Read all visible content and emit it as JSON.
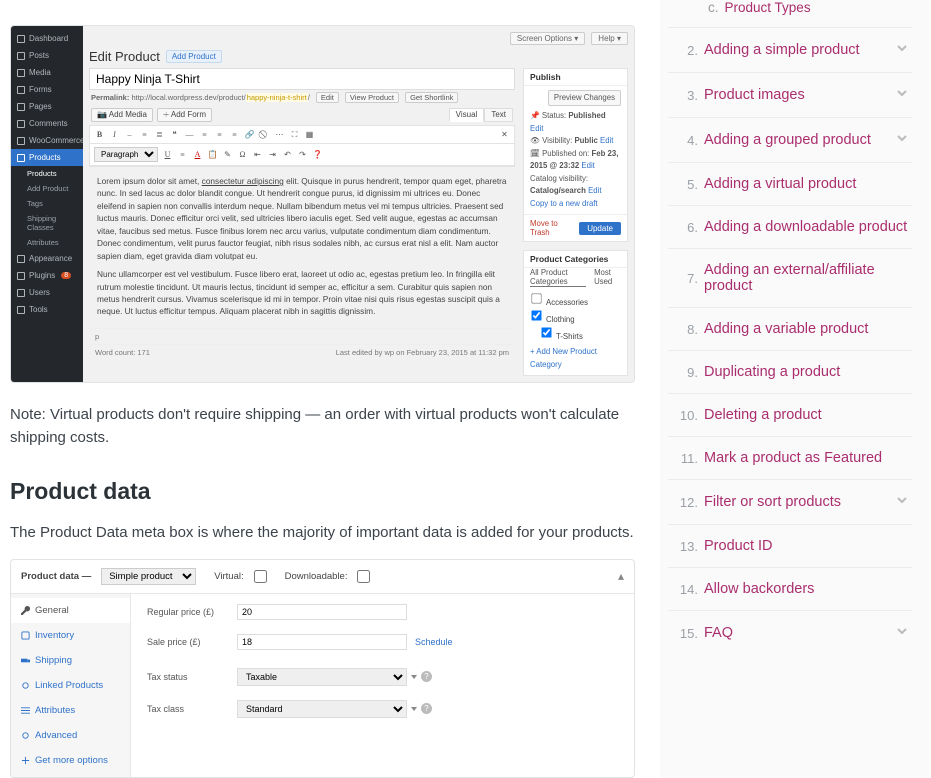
{
  "wp_shot": {
    "screen_options": "Screen Options",
    "help": "Help",
    "menu": [
      {
        "icon": "dash",
        "label": "Dashboard"
      },
      {
        "icon": "pin",
        "label": "Posts"
      },
      {
        "icon": "media",
        "label": "Media"
      },
      {
        "icon": "form",
        "label": "Forms"
      },
      {
        "icon": "page",
        "label": "Pages"
      },
      {
        "icon": "comment",
        "label": "Comments"
      },
      {
        "icon": "cart",
        "label": "WooCommerce"
      }
    ],
    "menu_active": "Products",
    "menu_sub": [
      "Products",
      "Add Product",
      "Tags",
      "Shipping Classes",
      "Attributes"
    ],
    "menu_after": [
      {
        "label": "Appearance",
        "icon": "brush"
      },
      {
        "label": "Plugins",
        "icon": "plug",
        "badge": "8"
      },
      {
        "label": "Users",
        "icon": "user"
      },
      {
        "label": "Tools",
        "icon": "wrench"
      }
    ],
    "page_title": "Edit Product",
    "add_new": "Add Product",
    "product_title": "Happy Ninja T-Shirt",
    "permalink_label": "Permalink:",
    "permalink_url": "http://local.wordpress.dev/product/",
    "permalink_slug": "happy-ninja-t-shirt",
    "permalink_edit": "Edit",
    "permalink_view": "View Product",
    "permalink_shortlink": "Get Shortlink",
    "add_media": "Add Media",
    "add_form": "Add Form",
    "tab_visual": "Visual",
    "tab_text": "Text",
    "tb_paragraph": "Paragraph",
    "content_p1_a": "Lorem ipsum dolor sit amet, ",
    "content_p1_u": "consectetur adipiscing",
    "content_p1_b": " elit. Quisque in purus hendrerit, tempor quam eget, pharetra nunc. In sed lacus ac dolor blandit congue. Ut hendrerit congue purus, id dignissim mi ultrices eu. Donec eleifend in sapien non convallis interdum neque. Nullam bibendum metus vel mi tempus ultricies. Praesent sed luctus mauris. Donec efficitur orci velit, sed ultricies libero iaculis eget. Sed velit augue, egestas ac accumsan vitae, faucibus sed metus. Fusce finibus lorem nec arcu varius, vulputate condimentum diam condimentum. Donec condimentum, velit purus fauctor feugiat, nibh risus sodales nibh, ac cursus erat nisl a elit. Nam auctor sapien diam, eget gravida diam volutpat eu.",
    "content_p2": "Nunc ullamcorper est vel vestibulum. Fusce libero erat, laoreet ut odio ac, egestas pretium leo. In fringilla elit rutrum molestie tincidunt. Ut mauris lectus, tincidunt id semper ac, efficitur a sem. Curabitur quis sapien non metus hendrerit cursus. Vivamus scelerisque id mi in tempor. Proin vitae nisi quis risus egestas suscipit quis a neque. Ut luctus efficitur tempus. Aliquam placerat nibh in sagittis dignissim.",
    "footer_p": "p",
    "wordcount": "Word count: 171",
    "lastedit": "Last edited by wp on February 23, 2015 at 11:32 pm",
    "publish": {
      "title": "Publish",
      "preview": "Preview Changes",
      "status_label": "Status:",
      "status_val": "Published",
      "visibility_label": "Visibility:",
      "visibility_val": "Public",
      "published_label": "Published on:",
      "published_val": "Feb 23, 2015 @ 23:32",
      "catalog_label": "Catalog visibility:",
      "catalog_val": "Catalog/search",
      "edit": "Edit",
      "copy": "Copy to a new draft",
      "trash": "Move to Trash",
      "update": "Update"
    },
    "cats": {
      "title": "Product Categories",
      "tab_all": "All Product Categories",
      "tab_used": "Most Used",
      "items": [
        "Accessories",
        "Clothing",
        "T-Shirts"
      ],
      "addnew": "+ Add New Product Category"
    }
  },
  "article": {
    "note": "Note: Virtual products don't require shipping — an order with virtual products won't calculate shipping costs.",
    "h2": "Product data",
    "p1": "The Product Data meta box is where the majority of important data is added for your products."
  },
  "pd_shot": {
    "header_label": "Product data —",
    "type": "Simple product",
    "virtual": "Virtual:",
    "downloadable": "Downloadable:",
    "tabs": [
      "General",
      "Inventory",
      "Shipping",
      "Linked Products",
      "Attributes",
      "Advanced",
      "Get more options"
    ],
    "rows": {
      "regprice_label": "Regular price (£)",
      "regprice_val": "20",
      "saleprice_label": "Sale price (£)",
      "saleprice_val": "18",
      "schedule": "Schedule",
      "taxstatus_label": "Tax status",
      "taxstatus_val": "Taxable",
      "taxclass_label": "Tax class",
      "taxclass_val": "Standard"
    }
  },
  "toc": {
    "sub_letter": "c.",
    "sub_label": "Product Types",
    "items": [
      {
        "n": "2.",
        "label": "Adding a simple product",
        "chev": true
      },
      {
        "n": "3.",
        "label": "Product images",
        "chev": true
      },
      {
        "n": "4.",
        "label": "Adding a grouped product",
        "chev": true
      },
      {
        "n": "5.",
        "label": "Adding a virtual product",
        "chev": false
      },
      {
        "n": "6.",
        "label": "Adding a downloadable product",
        "chev": false
      },
      {
        "n": "7.",
        "label": "Adding an external/affiliate product",
        "chev": false
      },
      {
        "n": "8.",
        "label": "Adding a variable product",
        "chev": false
      },
      {
        "n": "9.",
        "label": "Duplicating a product",
        "chev": false
      },
      {
        "n": "10.",
        "label": "Deleting a product",
        "chev": false
      },
      {
        "n": "11.",
        "label": "Mark a product as Featured",
        "chev": false
      },
      {
        "n": "12.",
        "label": "Filter or sort products",
        "chev": true
      },
      {
        "n": "13.",
        "label": "Product ID",
        "chev": false
      },
      {
        "n": "14.",
        "label": "Allow backorders",
        "chev": false
      },
      {
        "n": "15.",
        "label": "FAQ",
        "chev": true
      }
    ]
  }
}
